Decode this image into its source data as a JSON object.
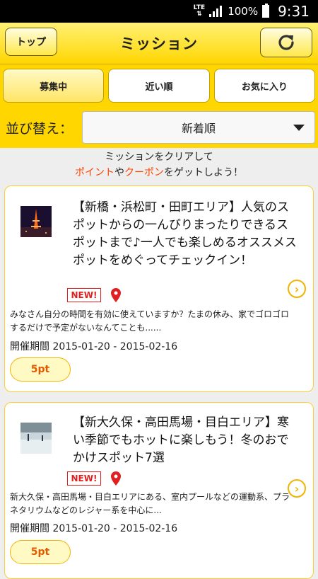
{
  "status_bar": {
    "network": "LTE",
    "battery": "100%",
    "time": "9:31"
  },
  "header": {
    "top_button": "トップ",
    "title": "ミッション",
    "refresh_icon": "refresh-icon"
  },
  "tabs": [
    {
      "label": "募集中",
      "active": true
    },
    {
      "label": "近い順",
      "active": false
    },
    {
      "label": "お気に入り",
      "active": false
    }
  ],
  "sort": {
    "label": "並び替え：",
    "selected": "新着順"
  },
  "notice": {
    "line1": "ミッションをクリアして",
    "points_word": "ポイント",
    "ya": "や",
    "coupon_word": "クーポン",
    "rest": "をゲットしよう！"
  },
  "missions": [
    {
      "title": "【新橋・浜松町・田町エリア】人気のスポットからの一んびりまったりできるスポットまで♪一人でも楽しめるオススメスポットをめぐってチェックイン！",
      "badge": "NEW!",
      "description": "みなさん自分の時間を有効に使えていますか？たまの休み、家でゴロゴロするだけで予定がないなんてことも......",
      "period": "開催期間 2015-01-20 - 2015-02-16",
      "points": "5pt"
    },
    {
      "title": "【新大久保・高田馬場・目白エリア】寒い季節でもホットに楽しもう！冬のおでかけスポット7選",
      "badge": "NEW!",
      "description": "新大久保・高田馬場・目白エリアにある、室内プールなどの運動系、プラネタリウムなどのレジャー系を中心に...",
      "period": "開催期間 2015-01-20 - 2015-02-16",
      "points": "5pt"
    }
  ],
  "colors": {
    "header_yellow": "#ffd600",
    "accent_orange": "#ff4500",
    "badge_red": "#e02020"
  }
}
